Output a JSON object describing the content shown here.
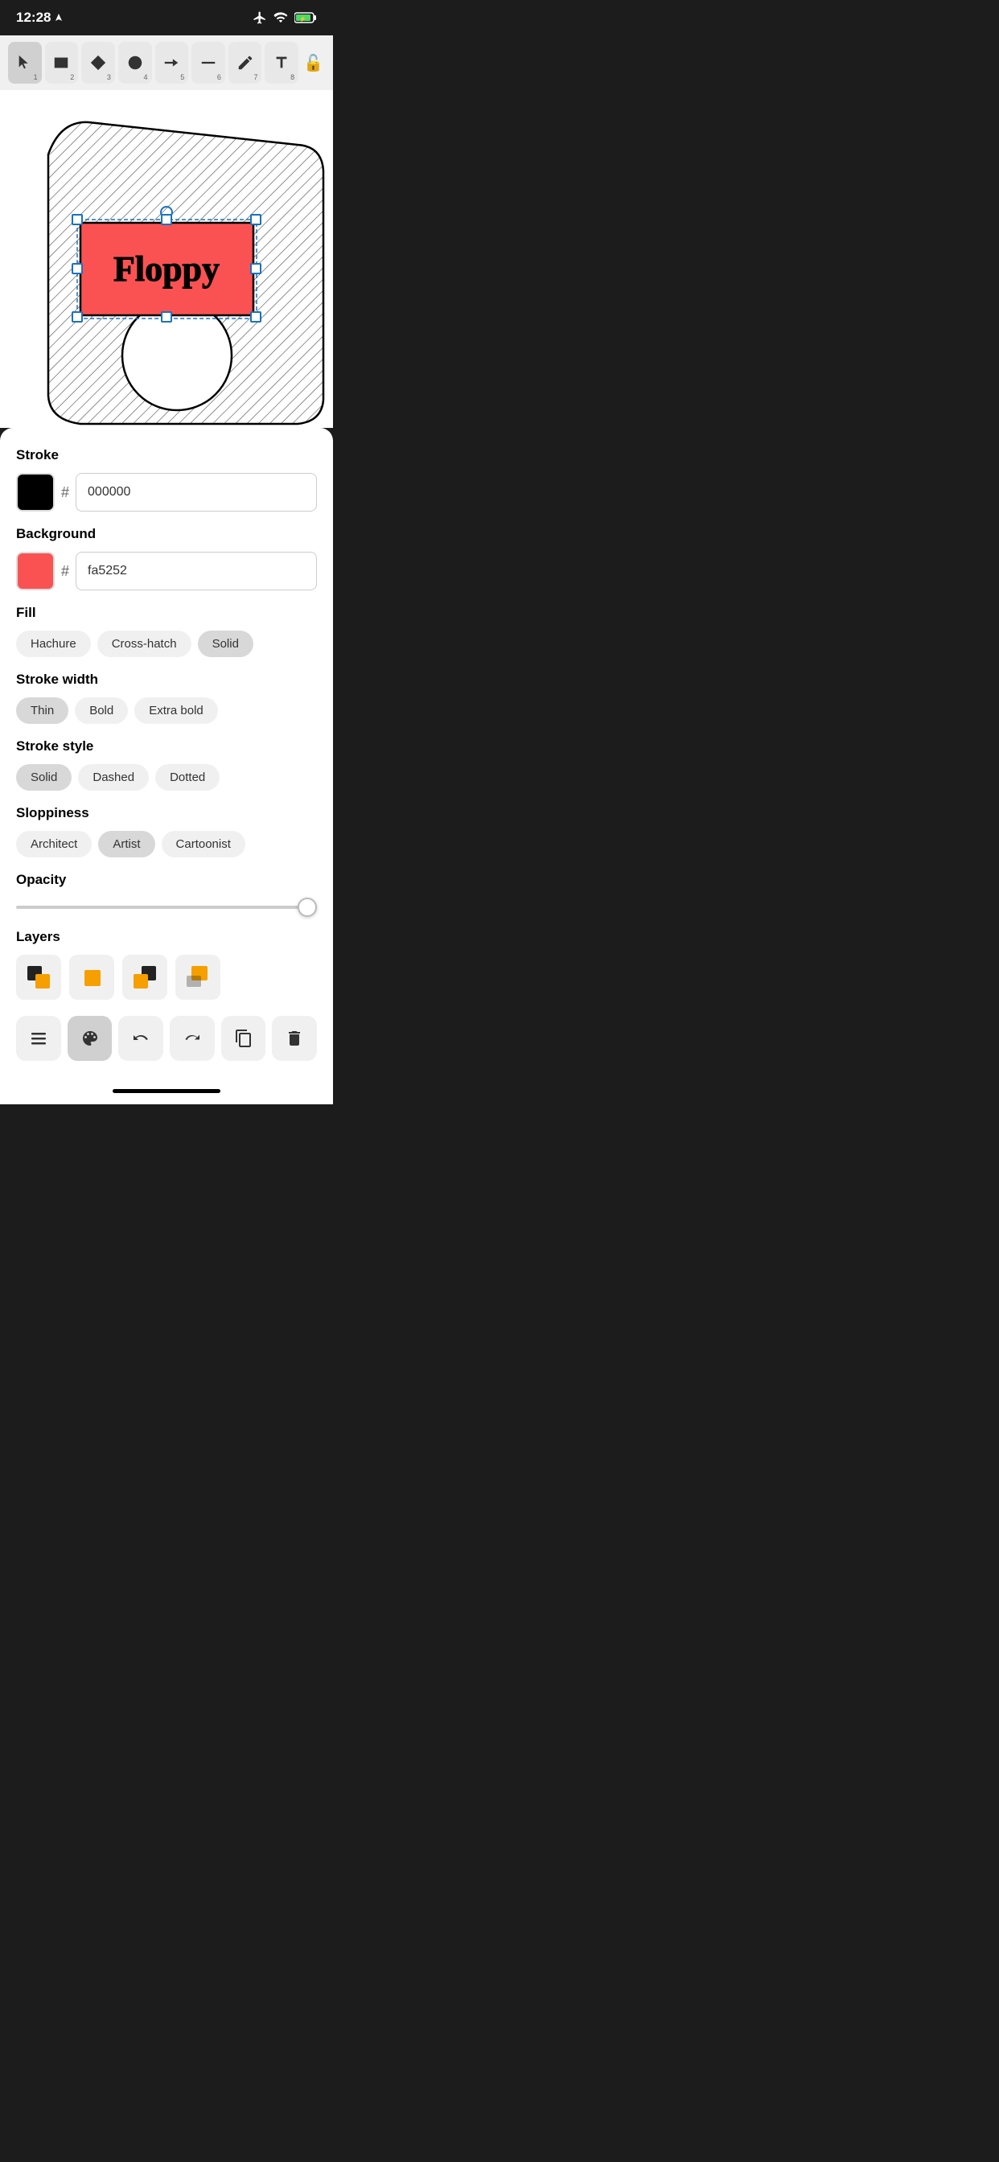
{
  "statusBar": {
    "time": "12:28",
    "locationIcon": "location-arrow-icon"
  },
  "toolbar": {
    "tools": [
      {
        "id": "select",
        "label": "▲",
        "num": "1",
        "active": true
      },
      {
        "id": "rect",
        "label": "■",
        "num": "2",
        "active": false
      },
      {
        "id": "diamond",
        "label": "◆",
        "num": "3",
        "active": false
      },
      {
        "id": "circle",
        "label": "●",
        "num": "4",
        "active": false
      },
      {
        "id": "arrow",
        "label": "→",
        "num": "5",
        "active": false
      },
      {
        "id": "line",
        "label": "—",
        "num": "6",
        "active": false
      },
      {
        "id": "pencil",
        "label": "✏",
        "num": "7",
        "active": false
      },
      {
        "id": "text",
        "label": "A",
        "num": "8",
        "active": false
      }
    ],
    "lockLabel": "🔓"
  },
  "canvas": {
    "elementText": "Floppy"
  },
  "panel": {
    "strokeLabel": "Stroke",
    "strokeColor": "#000000",
    "strokeHex": "000000",
    "backgroundLabel": "Background",
    "bgColor": "#fa5252",
    "bgHex": "fa5252",
    "fillLabel": "Fill",
    "fillOptions": [
      {
        "label": "Hachure",
        "active": false
      },
      {
        "label": "Cross-hatch",
        "active": false
      },
      {
        "label": "Solid",
        "active": true
      }
    ],
    "strokeWidthLabel": "Stroke width",
    "strokeWidthOptions": [
      {
        "label": "Thin",
        "active": true
      },
      {
        "label": "Bold",
        "active": false
      },
      {
        "label": "Extra bold",
        "active": false
      }
    ],
    "strokeStyleLabel": "Stroke style",
    "strokeStyleOptions": [
      {
        "label": "Solid",
        "active": true
      },
      {
        "label": "Dashed",
        "active": false
      },
      {
        "label": "Dotted",
        "active": false
      }
    ],
    "sloppinessLabel": "Sloppiness",
    "sloppinessOptions": [
      {
        "label": "Architect",
        "active": false
      },
      {
        "label": "Artist",
        "active": true
      },
      {
        "label": "Cartoonist",
        "active": false
      }
    ],
    "opacityLabel": "Opacity",
    "opacityValue": 100,
    "layersLabel": "Layers",
    "layerIcons": [
      {
        "id": "layer-1",
        "symbol": "⬛🟧"
      },
      {
        "id": "layer-2",
        "symbol": "🟧"
      },
      {
        "id": "layer-3",
        "symbol": "⬛🟧"
      },
      {
        "id": "layer-4",
        "symbol": "🟧"
      }
    ],
    "actions": [
      {
        "id": "menu",
        "symbol": "☰"
      },
      {
        "id": "style",
        "symbol": "🎨",
        "active": true
      },
      {
        "id": "undo",
        "symbol": "↺"
      },
      {
        "id": "redo",
        "symbol": "↻"
      },
      {
        "id": "copy",
        "symbol": "⧉"
      },
      {
        "id": "delete",
        "symbol": "🗑"
      }
    ]
  }
}
